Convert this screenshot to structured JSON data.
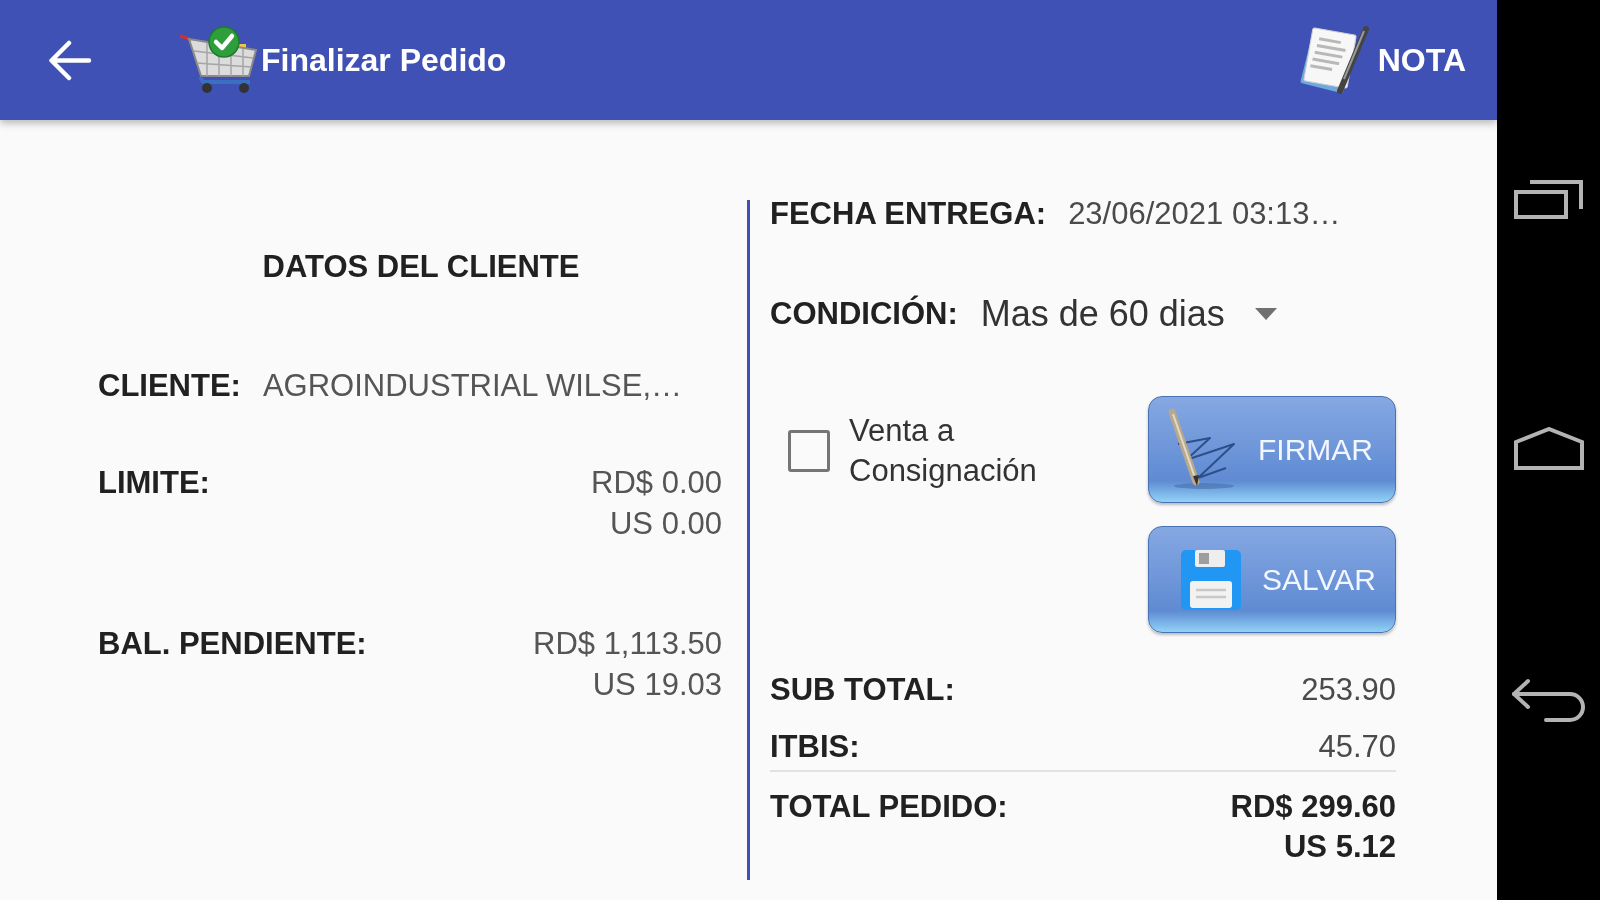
{
  "app_bar": {
    "title": "Finalizar Pedido",
    "action": "NOTA"
  },
  "client": {
    "heading": "DATOS DEL CLIENTE",
    "fields": [
      {
        "kind": "inline",
        "label": "CLIENTE:",
        "values": [
          "AGROINDUSTRIAL WILSE,…"
        ]
      },
      {
        "kind": "stacked",
        "label": "LIMITE:",
        "values": [
          "RD$ 0.00",
          "US 0.00"
        ]
      },
      {
        "kind": "stacked",
        "label": "BAL. PENDIENTE:",
        "values": [
          "RD$ 1,113.50",
          "US 19.03"
        ]
      }
    ]
  },
  "order": {
    "delivery_date": {
      "label": "FECHA ENTREGA:",
      "value": "23/06/2021 03:13…"
    },
    "condition": {
      "label": "CONDICIÓN:",
      "value": "Mas de 60 dias"
    },
    "consignment": {
      "label": "Venta a Consignación",
      "checked": false
    },
    "buttons": [
      {
        "kind": "sign",
        "label": "FIRMAR"
      },
      {
        "kind": "save",
        "label": "SALVAR"
      }
    ],
    "totals": [
      {
        "kind": "plain",
        "label": "SUB TOTAL:",
        "values": [
          "253.90"
        ]
      },
      {
        "kind": "plain",
        "label": "ITBIS:",
        "values": [
          "45.70"
        ]
      },
      {
        "kind": "grand",
        "label": "TOTAL PEDIDO:",
        "values": [
          "RD$ 299.60",
          "US 5.12"
        ]
      }
    ]
  }
}
